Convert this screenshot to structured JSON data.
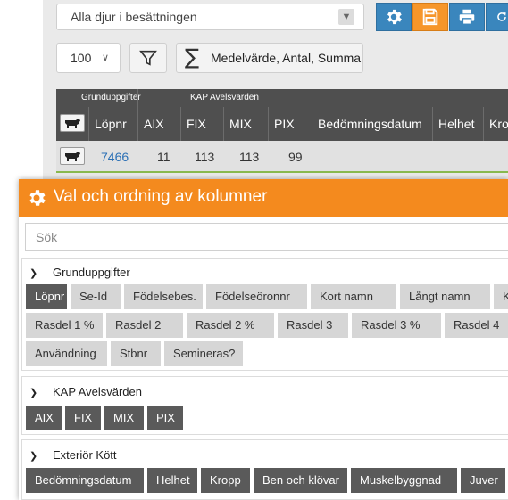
{
  "toolbar": {
    "herd_select": "Alla djur i besättningen",
    "page_size": "100",
    "summary_button": "Medelvärde, Antal, Summa"
  },
  "table": {
    "group_headers": [
      "Grunduppgifter",
      "KAP Avelsvärden"
    ],
    "columns": [
      "Löpnr",
      "AIX",
      "FIX",
      "MIX",
      "PIX",
      "Bedömningsdatum",
      "Helhet",
      "Kro"
    ],
    "row": {
      "lopnr": "7466",
      "aix": "11",
      "fix": "113",
      "mix": "113",
      "pix": "99"
    }
  },
  "modal": {
    "title": "Val och ordning av kolumner",
    "search_placeholder": "Sök",
    "sections": [
      {
        "title": "Grunduppgifter",
        "rows": [
          [
            {
              "label": "Löpnr",
              "selected": true
            },
            {
              "label": "Se-Id",
              "selected": false
            },
            {
              "label": "Födelsebes.",
              "selected": false
            },
            {
              "label": "Födelseöronnr",
              "selected": false
            },
            {
              "label": "Kort namn",
              "selected": false
            },
            {
              "label": "Långt namn",
              "selected": false
            },
            {
              "label": "Kön",
              "selected": false
            }
          ],
          [
            {
              "label": "Rasdel 1 %",
              "selected": false
            },
            {
              "label": "Rasdel 2",
              "selected": false
            },
            {
              "label": "Rasdel 2 %",
              "selected": false
            },
            {
              "label": "Rasdel 3",
              "selected": false
            },
            {
              "label": "Rasdel 3 %",
              "selected": false
            },
            {
              "label": "Rasdel 4",
              "selected": false
            }
          ],
          [
            {
              "label": "Användning",
              "selected": false
            },
            {
              "label": "Stbnr",
              "selected": false
            },
            {
              "label": "Semineras?",
              "selected": false
            }
          ]
        ]
      },
      {
        "title": "KAP Avelsvärden",
        "rows": [
          [
            {
              "label": "AIX",
              "selected": true
            },
            {
              "label": "FIX",
              "selected": true
            },
            {
              "label": "MIX",
              "selected": true
            },
            {
              "label": "PIX",
              "selected": true
            }
          ]
        ]
      },
      {
        "title": "Exteriör Kött",
        "rows": [
          [
            {
              "label": "Bedömningsdatum",
              "selected": true
            },
            {
              "label": "Helhet",
              "selected": true
            },
            {
              "label": "Kropp",
              "selected": true
            },
            {
              "label": "Ben och klövar",
              "selected": true
            },
            {
              "label": "Muskelbyggnad",
              "selected": true
            },
            {
              "label": "Juver",
              "selected": true
            }
          ]
        ]
      }
    ]
  },
  "colors": {
    "accent_orange": "#f48a1e",
    "toolbar_blue": "#3a86bd",
    "chip_selected": "#5a5a5a",
    "chip_unselected": "#d6d6d6",
    "link_blue": "#2a6fb5"
  },
  "icons": [
    "chevron-down-icon",
    "gear-icon",
    "save-icon",
    "print-icon",
    "refresh-icon",
    "filter-icon",
    "sigma-icon",
    "cow-icon"
  ]
}
